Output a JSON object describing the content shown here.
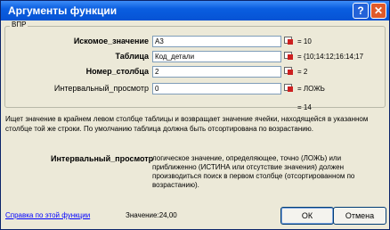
{
  "window": {
    "title": "Аргументы функции",
    "help_label": "?",
    "close_label": "✕"
  },
  "group": {
    "label": "ВПР"
  },
  "args": [
    {
      "label": "Искомое_значение",
      "value": "A3",
      "result": "= 10",
      "bold": true
    },
    {
      "label": "Таблица",
      "value": "Код_детали",
      "result": "= {10;14:12;16:14;17",
      "bold": true
    },
    {
      "label": "Номер_столбца",
      "value": "2",
      "result": "= 2",
      "bold": true
    },
    {
      "label": "Интервальный_просмотр",
      "value": "0",
      "result": "= ЛОЖЬ",
      "bold": false
    }
  ],
  "function_result": "= 14",
  "description": "Ищет значение в крайнем левом столбце таблицы и возвращает значение ячейки, находящейся в указанном столбце той же строки. По умолчанию таблица должна быть отсортирована по возрастанию.",
  "arg_help": {
    "label": "Интервальный_просмотр",
    "text": "логическое значение, определяющее, точно (ЛОЖЬ) или приближенно (ИСТИНА или отсутствие значения) должен производиться поиск в первом столбце (отсортированном по возрастанию)."
  },
  "footer": {
    "help_link": "Справка по этой функции",
    "calc_value": "Значение:24,00",
    "ok_label": "ОК",
    "cancel_label": "Отмена"
  }
}
